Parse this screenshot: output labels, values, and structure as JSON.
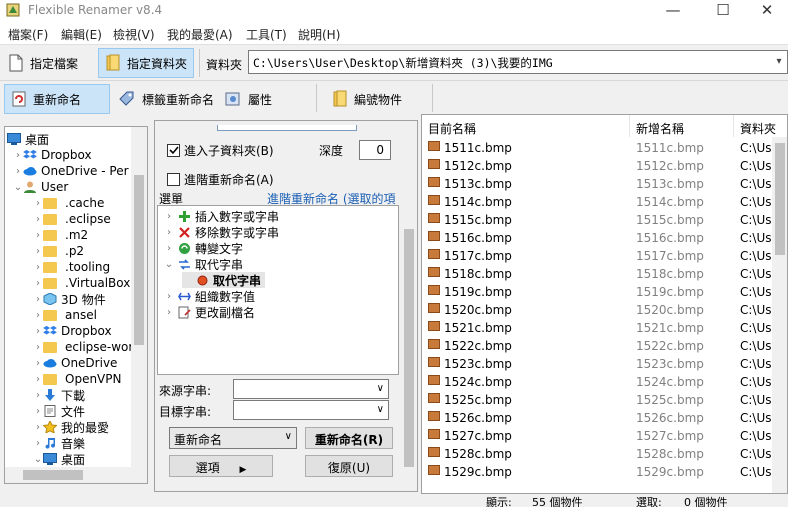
{
  "window": {
    "title": "Flexible Renamer v8.4",
    "minimize": "—",
    "maximize": "☐",
    "close": "✕"
  },
  "menu": [
    "檔案(F)",
    "編輯(E)",
    "檢視(V)",
    "我的最愛(A)",
    "工具(T)",
    "說明(H)"
  ],
  "toolbar1": {
    "file_btn": "指定檔案",
    "folder_btn": "指定資料夾",
    "path_label": "資料夾",
    "path_value": "C:\\Users\\User\\Desktop\\新增資料夾 (3)\\我要的IMG"
  },
  "toolbar2": {
    "rename": "重新命名",
    "tag_rename": "標籤重新命名",
    "attributes": "屬性",
    "numbering": "編號物件"
  },
  "tree": [
    {
      "label": "桌面",
      "level": 0,
      "icon": "desktop",
      "chev": ""
    },
    {
      "label": "Dropbox",
      "level": 1,
      "icon": "dropbox",
      "chev": ">"
    },
    {
      "label": "OneDrive - Per",
      "level": 1,
      "icon": "onedrive",
      "chev": ">"
    },
    {
      "label": "User",
      "level": 1,
      "icon": "user",
      "chev": "v"
    },
    {
      "label": ".cache",
      "level": 2,
      "icon": "folder",
      "chev": ">"
    },
    {
      "label": ".eclipse",
      "level": 2,
      "icon": "folder",
      "chev": ">"
    },
    {
      "label": ".m2",
      "level": 2,
      "icon": "folder",
      "chev": ">"
    },
    {
      "label": ".p2",
      "level": 2,
      "icon": "folder",
      "chev": ">"
    },
    {
      "label": ".tooling",
      "level": 2,
      "icon": "folder",
      "chev": ">"
    },
    {
      "label": ".VirtualBox",
      "level": 2,
      "icon": "folder",
      "chev": ">"
    },
    {
      "label": "3D 物件",
      "level": 2,
      "icon": "3d",
      "chev": ">"
    },
    {
      "label": "ansel",
      "level": 2,
      "icon": "folder",
      "chev": ">"
    },
    {
      "label": "Dropbox",
      "level": 2,
      "icon": "dropbox",
      "chev": ">"
    },
    {
      "label": "eclipse-wor",
      "level": 2,
      "icon": "folder",
      "chev": ">"
    },
    {
      "label": "OneDrive",
      "level": 2,
      "icon": "onedrive",
      "chev": ">"
    },
    {
      "label": "OpenVPN",
      "level": 2,
      "icon": "folder",
      "chev": ">"
    },
    {
      "label": "下載",
      "level": 2,
      "icon": "download",
      "chev": ">"
    },
    {
      "label": "文件",
      "level": 2,
      "icon": "doc",
      "chev": ">"
    },
    {
      "label": "我的最愛",
      "level": 2,
      "icon": "star",
      "chev": ">"
    },
    {
      "label": "音樂",
      "level": 2,
      "icon": "music",
      "chev": ">"
    },
    {
      "label": "桌面",
      "level": 2,
      "icon": "desktop",
      "chev": "v"
    }
  ],
  "options": {
    "subfolder": "進入子資料夾(B)",
    "depth_label": "深度",
    "depth_value": "0",
    "advanced": "進階重新命名(A)",
    "menu_label": "選單",
    "menu_link": "進階重新命名 (選取的項",
    "ops": [
      {
        "label": "插入數字或字串",
        "icon": "plus"
      },
      {
        "label": "移除數字或字串",
        "icon": "cross"
      },
      {
        "label": "轉變文字",
        "icon": "convert"
      },
      {
        "label": "取代字串",
        "icon": "replace"
      },
      {
        "label": "取代字串",
        "icon": "dot"
      },
      {
        "label": "組織數字值",
        "icon": "org"
      },
      {
        "label": "更改副檔名",
        "icon": "ext"
      }
    ],
    "source_label": "來源字串:",
    "target_label": "目標字串:",
    "mode_value": "重新命名",
    "rename_btn": "重新命名(R)",
    "options_btn": "選項",
    "restore_btn": "復原(U)"
  },
  "list": {
    "headers": [
      "目前名稱",
      "新增名稱",
      "資料夾"
    ],
    "rows": [
      {
        "current": "1511c.bmp",
        "new": "1511c.bmp",
        "folder": "C:\\Use"
      },
      {
        "current": "1512c.bmp",
        "new": "1512c.bmp",
        "folder": "C:\\Use"
      },
      {
        "current": "1513c.bmp",
        "new": "1513c.bmp",
        "folder": "C:\\Use"
      },
      {
        "current": "1514c.bmp",
        "new": "1514c.bmp",
        "folder": "C:\\Use"
      },
      {
        "current": "1515c.bmp",
        "new": "1515c.bmp",
        "folder": "C:\\Use"
      },
      {
        "current": "1516c.bmp",
        "new": "1516c.bmp",
        "folder": "C:\\Use"
      },
      {
        "current": "1517c.bmp",
        "new": "1517c.bmp",
        "folder": "C:\\Use"
      },
      {
        "current": "1518c.bmp",
        "new": "1518c.bmp",
        "folder": "C:\\Use"
      },
      {
        "current": "1519c.bmp",
        "new": "1519c.bmp",
        "folder": "C:\\Use"
      },
      {
        "current": "1520c.bmp",
        "new": "1520c.bmp",
        "folder": "C:\\Use"
      },
      {
        "current": "1521c.bmp",
        "new": "1521c.bmp",
        "folder": "C:\\Use"
      },
      {
        "current": "1522c.bmp",
        "new": "1522c.bmp",
        "folder": "C:\\Use"
      },
      {
        "current": "1523c.bmp",
        "new": "1523c.bmp",
        "folder": "C:\\Use"
      },
      {
        "current": "1524c.bmp",
        "new": "1524c.bmp",
        "folder": "C:\\Use"
      },
      {
        "current": "1525c.bmp",
        "new": "1525c.bmp",
        "folder": "C:\\Use"
      },
      {
        "current": "1526c.bmp",
        "new": "1526c.bmp",
        "folder": "C:\\Use"
      },
      {
        "current": "1527c.bmp",
        "new": "1527c.bmp",
        "folder": "C:\\Use"
      },
      {
        "current": "1528c.bmp",
        "new": "1528c.bmp",
        "folder": "C:\\Use"
      },
      {
        "current": "1529c.bmp",
        "new": "1529c.bmp",
        "folder": "C:\\Use"
      }
    ]
  },
  "status": {
    "shown_label": "顯示:",
    "shown_value": "55 個物件",
    "selected_label": "選取:",
    "selected_value": "0 個物件"
  },
  "colors": {
    "selected_bg": "#cce4f7",
    "link": "#1a5fb4",
    "new_name_gray": "#808080"
  }
}
